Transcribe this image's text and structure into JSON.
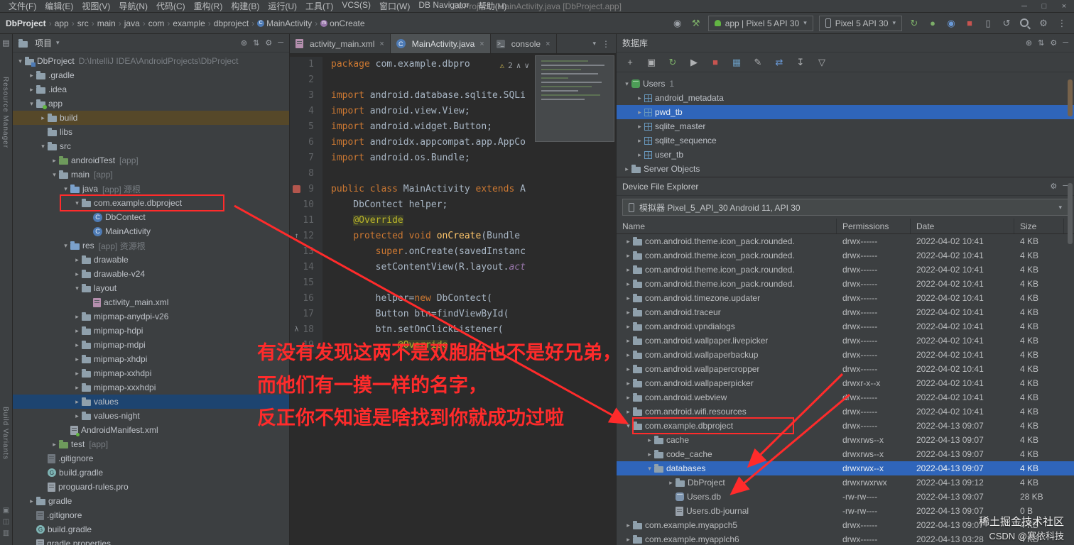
{
  "window": {
    "title": "DbProject - MainActivity.java [DbProject.app]",
    "menus": [
      "文件(F)",
      "编辑(E)",
      "视图(V)",
      "导航(N)",
      "代码(C)",
      "重构(R)",
      "构建(B)",
      "运行(U)",
      "工具(T)",
      "VCS(S)",
      "窗口(W)",
      "DB Navigator",
      "帮助(H)"
    ],
    "controls": [
      "minimize",
      "maximize",
      "close"
    ]
  },
  "toolbar": {
    "breadcrumbs": [
      {
        "t": "DbProject"
      },
      {
        "t": "app"
      },
      {
        "t": "src"
      },
      {
        "t": "main"
      },
      {
        "t": "java"
      },
      {
        "t": "com"
      },
      {
        "t": "example"
      },
      {
        "t": "dbproject"
      },
      {
        "t": "MainActivity",
        "i": "class"
      },
      {
        "t": "onCreate",
        "i": "method"
      }
    ],
    "run_config": "app | Pixel 5 API 30",
    "device_target": "Pixel 5 API 30",
    "icons_left": [
      "users",
      "build"
    ],
    "icons_right": [
      "apply-changes",
      "debug",
      "profile",
      "stop",
      "device-manager",
      "gradle-sync",
      "search",
      "settings",
      "more"
    ]
  },
  "left_strip": {
    "labels": [
      "Resource Manager",
      "Build Variants"
    ]
  },
  "project_panel": {
    "title": "项目",
    "head_icons": [
      "locate",
      "collapse",
      "settings",
      "hide"
    ],
    "items": [
      {
        "d": 0,
        "a": "v",
        "i": "project",
        "t": "DbProject",
        "x": "D:\\IntelliJ IDEA\\AndroidProjects\\DbProject"
      },
      {
        "d": 1,
        "a": ">",
        "i": "folder",
        "t": ".gradle"
      },
      {
        "d": 1,
        "a": ">",
        "i": "folder",
        "t": ".idea"
      },
      {
        "d": 1,
        "a": "v",
        "i": "module",
        "t": "app"
      },
      {
        "d": 2,
        "a": ">",
        "i": "folder",
        "t": "build",
        "hl": true
      },
      {
        "d": 2,
        "a": "",
        "i": "folder",
        "t": "libs"
      },
      {
        "d": 2,
        "a": "v",
        "i": "folder",
        "t": "src"
      },
      {
        "d": 3,
        "a": ">",
        "i": "folder-test",
        "t": "androidTest",
        "x": "[app]"
      },
      {
        "d": 3,
        "a": "v",
        "i": "folder",
        "t": "main",
        "x": "[app]"
      },
      {
        "d": 4,
        "a": "v",
        "i": "folder-src",
        "t": "java",
        "x": "[app] 源根"
      },
      {
        "d": 5,
        "a": "v",
        "i": "package",
        "t": "com.example.dbproject"
      },
      {
        "d": 6,
        "a": "",
        "i": "class",
        "t": "DbContect"
      },
      {
        "d": 6,
        "a": "",
        "i": "class",
        "t": "MainActivity"
      },
      {
        "d": 4,
        "a": "v",
        "i": "folder-res",
        "t": "res",
        "x": "[app] 资源根"
      },
      {
        "d": 5,
        "a": ">",
        "i": "folder",
        "t": "drawable"
      },
      {
        "d": 5,
        "a": ">",
        "i": "folder",
        "t": "drawable-v24"
      },
      {
        "d": 5,
        "a": "v",
        "i": "folder",
        "t": "layout"
      },
      {
        "d": 6,
        "a": "",
        "i": "xml",
        "t": "activity_main.xml"
      },
      {
        "d": 5,
        "a": ">",
        "i": "folder",
        "t": "mipmap-anydpi-v26"
      },
      {
        "d": 5,
        "a": ">",
        "i": "folder",
        "t": "mipmap-hdpi"
      },
      {
        "d": 5,
        "a": ">",
        "i": "folder",
        "t": "mipmap-mdpi"
      },
      {
        "d": 5,
        "a": ">",
        "i": "folder",
        "t": "mipmap-xhdpi"
      },
      {
        "d": 5,
        "a": ">",
        "i": "folder",
        "t": "mipmap-xxhdpi"
      },
      {
        "d": 5,
        "a": ">",
        "i": "folder",
        "t": "mipmap-xxxhdpi"
      },
      {
        "d": 5,
        "a": ">",
        "i": "folder",
        "t": "values",
        "sel": true
      },
      {
        "d": 5,
        "a": ">",
        "i": "folder",
        "t": "values-night"
      },
      {
        "d": 4,
        "a": "",
        "i": "manifest",
        "t": "AndroidManifest.xml"
      },
      {
        "d": 3,
        "a": ">",
        "i": "folder-test",
        "t": "test",
        "x": "[app]"
      },
      {
        "d": 2,
        "a": "",
        "i": "ignore",
        "t": ".gitignore"
      },
      {
        "d": 2,
        "a": "",
        "i": "gradle",
        "t": "build.gradle"
      },
      {
        "d": 2,
        "a": "",
        "i": "file",
        "t": "proguard-rules.pro"
      },
      {
        "d": 1,
        "a": ">",
        "i": "folder",
        "t": "gradle"
      },
      {
        "d": 1,
        "a": "",
        "i": "ignore",
        "t": ".gitignore"
      },
      {
        "d": 1,
        "a": "",
        "i": "gradle",
        "t": "build.gradle"
      },
      {
        "d": 1,
        "a": "",
        "i": "file",
        "t": "gradle.properties"
      }
    ]
  },
  "editor": {
    "tabs": [
      {
        "label": "activity_main.xml",
        "icon": "xml"
      },
      {
        "label": "MainActivity.java",
        "icon": "class",
        "active": true
      },
      {
        "label": "console",
        "icon": "console"
      }
    ],
    "warning_count": "2",
    "gutter_icons": {
      "9": "class",
      "12": "override",
      "18": "lambda"
    },
    "lines": [
      {
        "n": 1,
        "s": [
          [
            "package ",
            "kw"
          ],
          [
            "com.example.dbpro",
            "pl"
          ]
        ]
      },
      {
        "n": 2,
        "s": []
      },
      {
        "n": 3,
        "s": [
          [
            "import ",
            "kw"
          ],
          [
            "android.database.sqlite.SQLi",
            "pl"
          ]
        ]
      },
      {
        "n": 4,
        "s": [
          [
            "import ",
            "kw"
          ],
          [
            "android.view.View;",
            "pl"
          ]
        ]
      },
      {
        "n": 5,
        "s": [
          [
            "import ",
            "kw"
          ],
          [
            "android.widget.Button;",
            "pl"
          ]
        ]
      },
      {
        "n": 6,
        "s": [
          [
            "import ",
            "kw"
          ],
          [
            "androidx.appcompat.app.AppCo",
            "pl"
          ]
        ]
      },
      {
        "n": 7,
        "s": [
          [
            "import ",
            "kw"
          ],
          [
            "android.os.Bundle;",
            "pl"
          ]
        ]
      },
      {
        "n": 8,
        "s": []
      },
      {
        "n": 9,
        "s": [
          [
            "public class ",
            "kw"
          ],
          [
            "MainActivity ",
            "pl"
          ],
          [
            "extends ",
            "kw"
          ],
          [
            "A",
            "pl"
          ]
        ]
      },
      {
        "n": 10,
        "s": [
          [
            "    DbContect helper;",
            "pl"
          ]
        ]
      },
      {
        "n": 11,
        "s": [
          [
            "    ",
            "pl"
          ],
          [
            "@Override",
            "ann hl"
          ]
        ]
      },
      {
        "n": 12,
        "s": [
          [
            "    ",
            "pl"
          ],
          [
            "protected void ",
            "kw"
          ],
          [
            "onCreate",
            "mth"
          ],
          [
            "(Bundle",
            "pl"
          ]
        ]
      },
      {
        "n": 13,
        "s": [
          [
            "        ",
            "pl"
          ],
          [
            "super",
            "kw"
          ],
          [
            ".onCreate(savedInstanc",
            "pl"
          ]
        ]
      },
      {
        "n": 14,
        "s": [
          [
            "        setContentView(R.layout.",
            "pl"
          ],
          [
            "act",
            "itl"
          ]
        ]
      },
      {
        "n": 15,
        "s": []
      },
      {
        "n": 16,
        "s": [
          [
            "        helper=",
            "pl"
          ],
          [
            "new ",
            "kw"
          ],
          [
            "DbContect(",
            "pl"
          ]
        ]
      },
      {
        "n": 17,
        "s": [
          [
            "        Button btn=findViewById(",
            "pl"
          ]
        ]
      },
      {
        "n": 18,
        "s": [
          [
            "        btn.setOnClickListener(",
            "pl"
          ]
        ]
      },
      {
        "n": 19,
        "s": [
          [
            "            ",
            "pl"
          ],
          [
            "@Override",
            "ann hl"
          ]
        ]
      }
    ]
  },
  "database_panel": {
    "title": "数据库",
    "head_icons": [
      "locate",
      "collapse",
      "settings",
      "hide"
    ],
    "toolbar_icons": [
      "add",
      "copy",
      "refresh",
      "submit",
      "stop",
      "table",
      "edit",
      "sync",
      "export",
      "filter"
    ],
    "items": [
      {
        "d": 0,
        "a": "v",
        "i": "db",
        "t": "Users",
        "badge": "1"
      },
      {
        "d": 1,
        "a": ">",
        "i": "table",
        "t": "android_metadata"
      },
      {
        "d": 1,
        "a": ">",
        "i": "table",
        "t": "pwd_tb",
        "sel": true
      },
      {
        "d": 1,
        "a": ">",
        "i": "table",
        "t": "sqlite_master"
      },
      {
        "d": 1,
        "a": ">",
        "i": "table",
        "t": "sqlite_sequence"
      },
      {
        "d": 1,
        "a": ">",
        "i": "table",
        "t": "user_tb"
      },
      {
        "d": 0,
        "a": ">",
        "i": "server",
        "t": "Server Objects"
      }
    ]
  },
  "device_explorer": {
    "title": "Device File Explorer",
    "head_icons": [
      "settings",
      "hide"
    ],
    "device": "模拟器 Pixel_5_API_30 Android 11, API 30",
    "columns": [
      "Name",
      "Permissions",
      "Date",
      "Size"
    ],
    "rows": [
      {
        "d": 0,
        "a": ">",
        "i": "folder",
        "t": "com.android.theme.icon_pack.rounded.",
        "p": "drwx------",
        "dt": "2022-04-02 10:41",
        "sz": "4 KB"
      },
      {
        "d": 0,
        "a": ">",
        "i": "folder",
        "t": "com.android.theme.icon_pack.rounded.",
        "p": "drwx------",
        "dt": "2022-04-02 10:41",
        "sz": "4 KB"
      },
      {
        "d": 0,
        "a": ">",
        "i": "folder",
        "t": "com.android.theme.icon_pack.rounded.",
        "p": "drwx------",
        "dt": "2022-04-02 10:41",
        "sz": "4 KB"
      },
      {
        "d": 0,
        "a": ">",
        "i": "folder",
        "t": "com.android.theme.icon_pack.rounded.",
        "p": "drwx------",
        "dt": "2022-04-02 10:41",
        "sz": "4 KB"
      },
      {
        "d": 0,
        "a": ">",
        "i": "folder",
        "t": "com.android.timezone.updater",
        "p": "drwx------",
        "dt": "2022-04-02 10:41",
        "sz": "4 KB"
      },
      {
        "d": 0,
        "a": ">",
        "i": "folder",
        "t": "com.android.traceur",
        "p": "drwx------",
        "dt": "2022-04-02 10:41",
        "sz": "4 KB"
      },
      {
        "d": 0,
        "a": ">",
        "i": "folder",
        "t": "com.android.vpndialogs",
        "p": "drwx------",
        "dt": "2022-04-02 10:41",
        "sz": "4 KB"
      },
      {
        "d": 0,
        "a": ">",
        "i": "folder",
        "t": "com.android.wallpaper.livepicker",
        "p": "drwx------",
        "dt": "2022-04-02 10:41",
        "sz": "4 KB"
      },
      {
        "d": 0,
        "a": ">",
        "i": "folder",
        "t": "com.android.wallpaperbackup",
        "p": "drwx------",
        "dt": "2022-04-02 10:41",
        "sz": "4 KB"
      },
      {
        "d": 0,
        "a": ">",
        "i": "folder",
        "t": "com.android.wallpapercropper",
        "p": "drwx------",
        "dt": "2022-04-02 10:41",
        "sz": "4 KB"
      },
      {
        "d": 0,
        "a": ">",
        "i": "folder",
        "t": "com.android.wallpaperpicker",
        "p": "drwxr-x--x",
        "dt": "2022-04-02 10:41",
        "sz": "4 KB"
      },
      {
        "d": 0,
        "a": ">",
        "i": "folder",
        "t": "com.android.webview",
        "p": "drwx------",
        "dt": "2022-04-02 10:41",
        "sz": "4 KB"
      },
      {
        "d": 0,
        "a": ">",
        "i": "folder",
        "t": "com.android.wifi.resources",
        "p": "drwx------",
        "dt": "2022-04-02 10:41",
        "sz": "4 KB"
      },
      {
        "d": 0,
        "a": "v",
        "i": "folder",
        "t": "com.example.dbproject",
        "p": "drwx------",
        "dt": "2022-04-13 09:07",
        "sz": "4 KB"
      },
      {
        "d": 1,
        "a": ">",
        "i": "folder",
        "t": "cache",
        "p": "drwxrws--x",
        "dt": "2022-04-13 09:07",
        "sz": "4 KB"
      },
      {
        "d": 1,
        "a": ">",
        "i": "folder",
        "t": "code_cache",
        "p": "drwxrws--x",
        "dt": "2022-04-13 09:07",
        "sz": "4 KB"
      },
      {
        "d": 1,
        "a": "v",
        "i": "folder",
        "t": "databases",
        "p": "drwxrwx--x",
        "dt": "2022-04-13 09:07",
        "sz": "4 KB",
        "sel": true
      },
      {
        "d": 2,
        "a": ">",
        "i": "folder",
        "t": "DbProject",
        "p": "drwxrwxrwx",
        "dt": "2022-04-13 09:12",
        "sz": "4 KB"
      },
      {
        "d": 2,
        "a": "",
        "i": "db-file",
        "t": "Users.db",
        "p": "-rw-rw----",
        "dt": "2022-04-13 09:07",
        "sz": "28 KB"
      },
      {
        "d": 2,
        "a": "",
        "i": "file",
        "t": "Users.db-journal",
        "p": "-rw-rw----",
        "dt": "2022-04-13 09:07",
        "sz": "0 B"
      },
      {
        "d": 0,
        "a": ">",
        "i": "folder",
        "t": "com.example.myappch5",
        "p": "drwx------",
        "dt": "2022-04-13 09:07",
        "sz": "4 KB"
      },
      {
        "d": 0,
        "a": ">",
        "i": "folder",
        "t": "com.example.myapplch6",
        "p": "drwx------",
        "dt": "2022-04-13 03:28",
        "sz": "4 KB"
      }
    ]
  },
  "annotation": {
    "lines": [
      "有没有发现这两不是双胞胎也不是好兄弟，",
      "而他们有一摸一样的名字，",
      "反正你不知道是啥找到你就成功过啦"
    ]
  },
  "watermark": {
    "line1": "稀土掘金技术社区",
    "line2": "CSDN @寒依科技"
  },
  "colors": {
    "accent_red": "#ff2b2b",
    "selection_blue": "#2f65ba",
    "keyword_orange": "#cc7832",
    "annotation_yellow": "#bbb529"
  }
}
